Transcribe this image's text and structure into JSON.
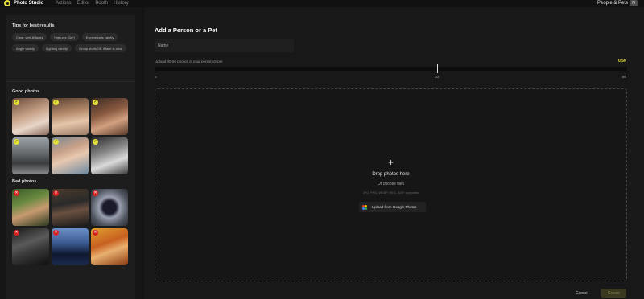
{
  "app": {
    "title": "Photo Studio",
    "nav": [
      "Actions",
      "Editor",
      "Booth",
      "History"
    ],
    "people_pets": "People & Pets",
    "avatar_initial": "N"
  },
  "tips": {
    "title": "Tips for best results",
    "chips": [
      "Clear, well-lit faces",
      "High-res (1k+)",
      "Expressions variety",
      "Angle variety",
      "Lighting variety",
      "Group shots OK if face is clear"
    ]
  },
  "good_photos": {
    "title": "Good photos",
    "count": 6
  },
  "bad_photos": {
    "title": "Bad photos",
    "count": 6
  },
  "form": {
    "title": "Add a Person or a Pet",
    "name_placeholder": "Name",
    "upload_hint": "Upload 30-50 photos of your person or pet",
    "counter": "0/50",
    "progress_fraction": 0,
    "scale": [
      "0",
      "30",
      "50"
    ]
  },
  "dropzone": {
    "plus": "+",
    "title": "Drop photos here",
    "choose": "Or choose files",
    "formats": "JPG, PNG, WEBP, HEIC, AVIF supported",
    "google_button": "Upload from Google Photos"
  },
  "footer": {
    "cancel": "Cancel",
    "create": "Create"
  },
  "colors": {
    "accent": "#e4e03a",
    "bad": "#d72020"
  }
}
